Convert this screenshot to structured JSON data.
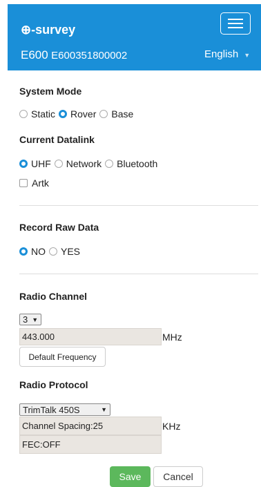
{
  "header": {
    "brand": "⊕-survey",
    "logo_icon": "globe-icon",
    "model": "E600",
    "serial": "E600351800002",
    "language": "English",
    "menu_icon": "hamburger-menu-icon",
    "bg_color": "#1a8fd8"
  },
  "system_mode": {
    "title": "System Mode",
    "options": [
      "Static",
      "Rover",
      "Base"
    ],
    "selected": "Rover"
  },
  "datalink": {
    "title": "Current Datalink",
    "options": [
      "UHF",
      "Network",
      "Bluetooth"
    ],
    "selected": "UHF",
    "artk_label": "Artk",
    "artk_checked": false
  },
  "raw_data": {
    "title": "Record Raw Data",
    "options": [
      "NO",
      "YES"
    ],
    "selected": "NO"
  },
  "radio_channel": {
    "title": "Radio Channel",
    "channel": "3",
    "frequency": "443.000",
    "frequency_unit": "MHz",
    "default_button": "Default Frequency"
  },
  "radio_protocol": {
    "title": "Radio Protocol",
    "protocol": "TrimTalk 450S",
    "spacing": "Channel Spacing:25",
    "spacing_unit": "KHz",
    "fec": "FEC:OFF"
  },
  "actions": {
    "save": "Save",
    "cancel": "Cancel",
    "save_color": "#5cb85c"
  }
}
